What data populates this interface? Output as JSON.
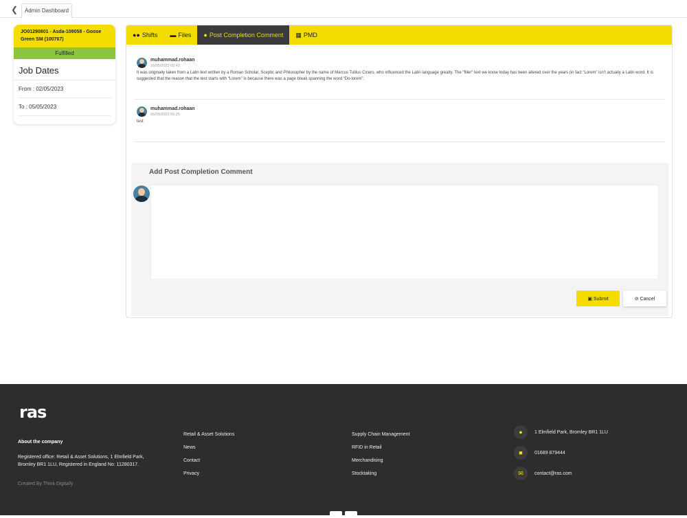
{
  "topbar": {
    "crumb": "Admin Dashboard"
  },
  "job": {
    "header": "JO01290801 - Asda-109058 - Goose Green SM (100767)",
    "status": "Fulfilled",
    "title": "Job Dates",
    "from": "From : 02/05/2023",
    "to": "To : 05/05/2023"
  },
  "tabs": [
    {
      "label": "Shifts",
      "icon": "users-icon"
    },
    {
      "label": "Files",
      "icon": "folder-icon"
    },
    {
      "label": "Post Completion Comment",
      "icon": "comments-icon"
    },
    {
      "label": "PMD",
      "icon": "file-edit-icon"
    }
  ],
  "comments": [
    {
      "user": "muhammad.rohaan",
      "time": "16/05/2023 02:43",
      "text": "It was originally taken from a Latin text written by a Roman Scholar, Sceptic and Philosopher by the name of Marcus Tullius Cicero, who influenced the Latin language greatly. The “filler” text we know today has been altered over the years (in fact “Lorem” isn’t actually a Latin word. It is suggested that the reason that the text starts with “Lorem” is because there was a page break spanning the word “Do-lorem”."
    },
    {
      "user": "muhammad.rohaan",
      "time": "05/05/2023 05:25",
      "text": "test"
    }
  ],
  "add_comment": {
    "title": "Add Post Completion Comment",
    "submit_label": "Submit",
    "cancel_label": "Cancel"
  },
  "footer": {
    "logo": "ras",
    "about_title": "About the company",
    "about_text": "Registered office: Retail & Asset Solutions, 1 Elmfield Park, Bromley BR1 1LU, Registered in England No: 11280317.",
    "credit": "Created By Think Digitally",
    "links_col1": [
      "Retail & Asset Solutions",
      "News",
      "Contact",
      "Privacy"
    ],
    "links_col2": [
      "Supply Chain Management",
      "RFID in Retail",
      "Merchandising",
      "Stocktaking"
    ],
    "address": "1 Elmfield Park, Bromley BR1 1LU",
    "phone": "01689 879444",
    "email": "contact@ras.com"
  },
  "colors": {
    "accent": "#f3dc00",
    "status": "#8cc63f",
    "footer_bg": "#2d2d2d",
    "active_tab": "#3a3a3a"
  }
}
